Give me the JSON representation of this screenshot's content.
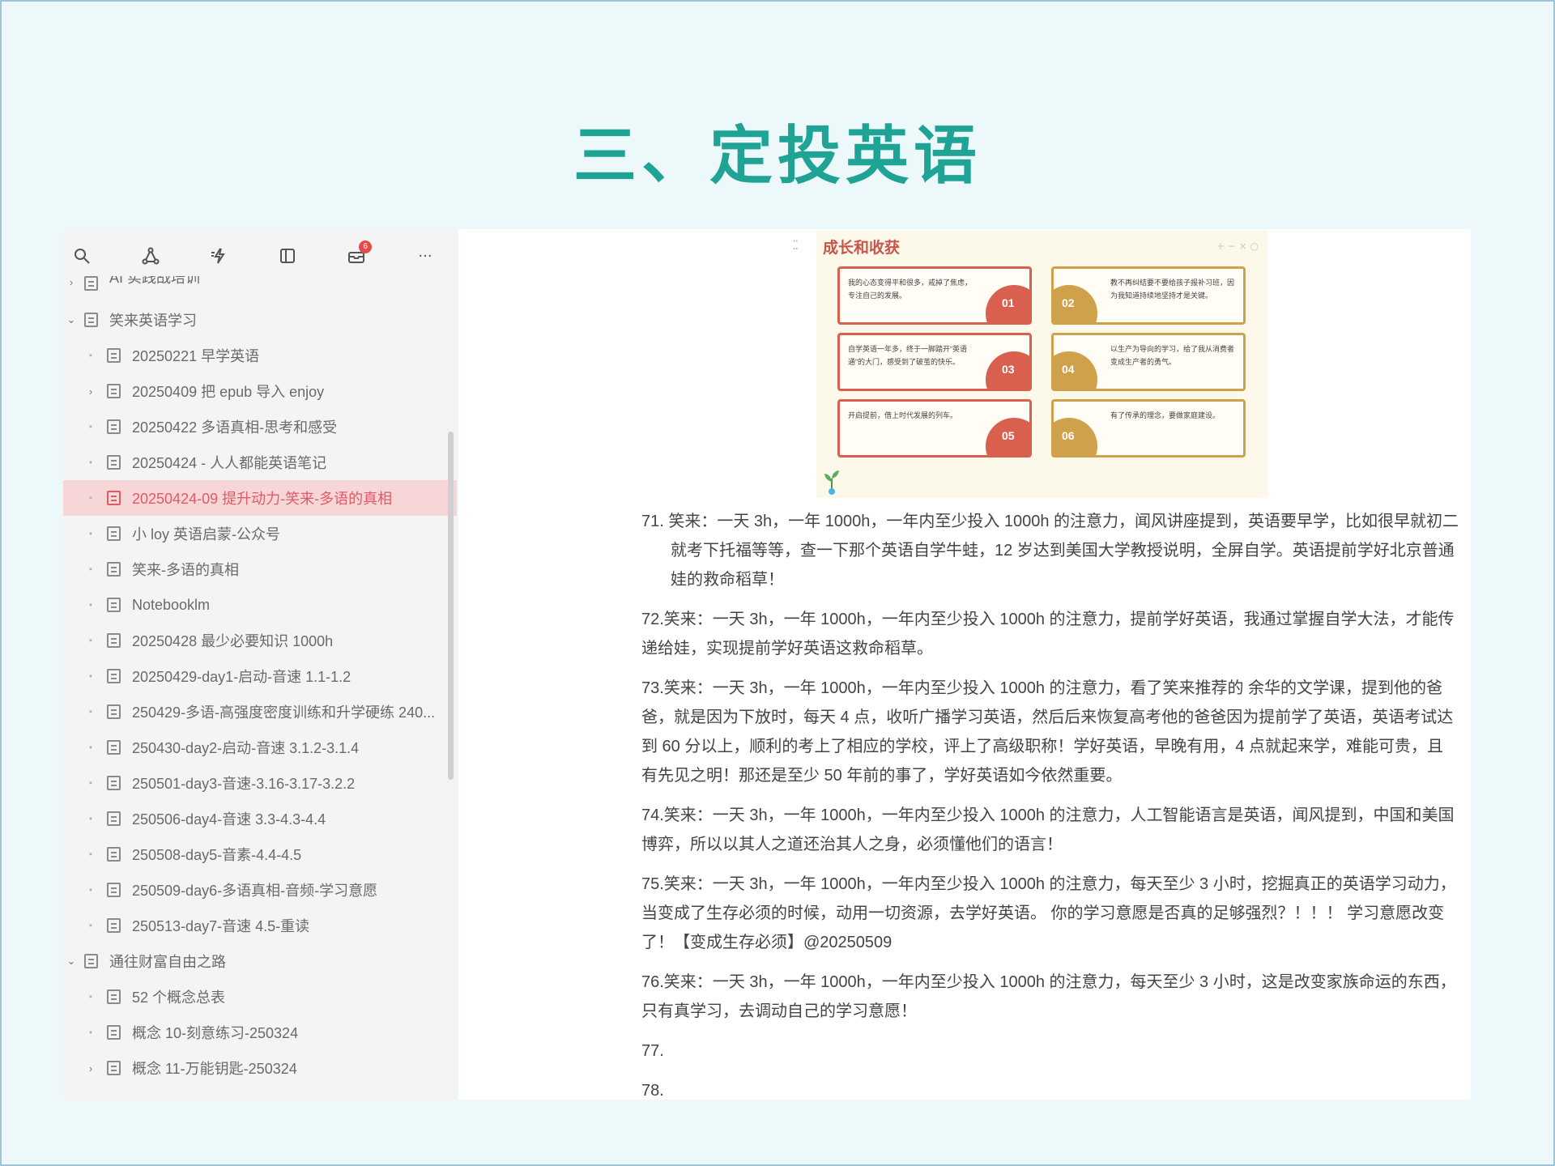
{
  "slide": {
    "title": "三、定投英语"
  },
  "toolbar": {
    "icons": [
      "search-icon",
      "graph-icon",
      "lightning-icon",
      "panel-icon",
      "inbox-icon",
      "more-icon"
    ],
    "inbox_badge": "6",
    "more_label": "···"
  },
  "tree": {
    "partial_top": "AI 实践战培训",
    "group1": {
      "label": "笑来英语学习",
      "items": [
        "20250221 早学英语",
        "20250409 把 epub 导入 enjoy",
        "20250422 多语真相-思考和感受",
        "20250424 - 人人都能英语笔记",
        "20250424-09 提升动力-笑来-多语的真相",
        "小 loy 英语启蒙-公众号",
        "笑来-多语的真相",
        "Notebooklm",
        "20250428 最少必要知识 1000h",
        "20250429-day1-启动-音速 1.1-1.2",
        "250429-多语-高强度密度训练和升学硬练 240...",
        "250430-day2-启动-音速 3.1.2-3.1.4",
        "250501-day3-音速-3.16-3.17-3.2.2",
        "250506-day4-音速 3.3-4.3-4.4",
        "250508-day5-音素-4.4-4.5",
        "250509-day6-多语真相-音频-学习意愿",
        "250513-day7-音速 4.5-重读"
      ],
      "active_index": 4,
      "expandable_index": 1
    },
    "group2": {
      "label": "通往财富自由之路",
      "items": [
        "52 个概念总表",
        "概念 10-刻意练习-250324",
        "概念 11-万能钥匙-250324"
      ]
    }
  },
  "infographic": {
    "title": "成长和收获",
    "tools": "+ − × ○",
    "cards": [
      {
        "num": "01",
        "text": "我的心态变得平和很多，戒掉了焦虑，专注自己的发展。"
      },
      {
        "num": "02",
        "text": "教不再纠结要不要给孩子报补习班，因为我知道持续地坚持才是关键。"
      },
      {
        "num": "03",
        "text": "自学英语一年多，终于一脚踏开“英语通”的大门，感受到了破茧的快乐。"
      },
      {
        "num": "04",
        "text": "以生产为导向的学习，给了我从消费者变成生产者的勇气。"
      },
      {
        "num": "05",
        "text": "开启提前，借上时代发展的列车。"
      },
      {
        "num": "06",
        "text": "有了传承的理念，要做家庭建设。"
      }
    ]
  },
  "notes": [
    "71. 笑来：一天 3h，一年 1000h，一年内至少投入 1000h 的注意力，闻风讲座提到，英语要早学，比如很早就初二就考下托福等等，查一下那个英语自学牛蛙，12 岁达到美国大学教授说明，全屏自学。英语提前学好北京普通娃的救命稻草！",
    "72.笑来：一天 3h，一年 1000h，一年内至少投入 1000h 的注意力，提前学好英语，我通过掌握自学大法，才能传递给娃，实现提前学好英语这救命稻草。",
    "73.笑来：一天 3h，一年 1000h，一年内至少投入 1000h 的注意力，看了笑来推荐的 余华的文学课，提到他的爸爸，就是因为下放时，每天 4 点，收听广播学习英语，然后后来恢复高考他的爸爸因为提前学了英语，英语考试达到 60 分以上，顺利的考上了相应的学校，评上了高级职称！学好英语，早晚有用，4 点就起来学，难能可贵，且有先见之明！那还是至少 50 年前的事了，学好英语如今依然重要。",
    "74.笑来：一天 3h，一年 1000h，一年内至少投入 1000h 的注意力，人工智能语言是英语，闻风提到，中国和美国博弈，所以以其人之道还治其人之身，必须懂他们的语言！",
    "75.笑来：一天 3h，一年 1000h，一年内至少投入 1000h 的注意力，每天至少 3 小时，挖掘真正的英语学习动力，当变成了生存必须的时候，动用一切资源，去学好英语。 你的学习意愿是否真的足够强烈？！！！ 学习意愿改变了！【变成生存必须】@20250509",
    "76.笑来：一天 3h，一年 1000h，一年内至少投入 1000h 的注意力，每天至少 3 小时，这是改变家族命运的东西，只有真学习，去调动自己的学习意愿！",
    "77.",
    "78."
  ],
  "colors": {
    "title": "#1fa395",
    "active": "#e05a63",
    "card_red": "#d9604f",
    "card_gold": "#cfa14a"
  }
}
